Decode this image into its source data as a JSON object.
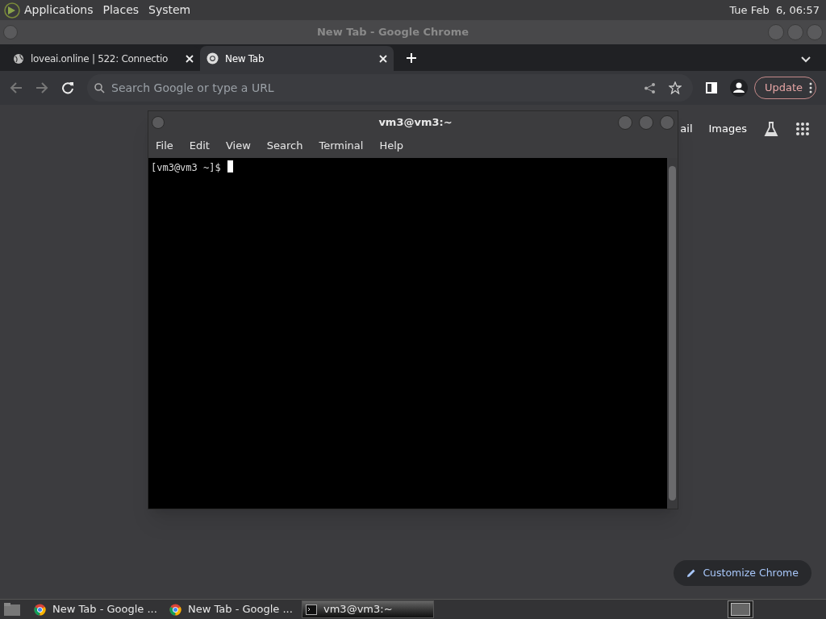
{
  "top_panel": {
    "menus": [
      "Applications",
      "Places",
      "System"
    ],
    "clock": "Tue Feb  6, 06:57"
  },
  "browser": {
    "title": "New Tab - Google Chrome",
    "tabs": [
      {
        "label": "loveai.online | 522: Connectio",
        "kind": "globe",
        "selected": false
      },
      {
        "label": "New Tab",
        "kind": "chrome",
        "selected": true
      }
    ],
    "omnibox": {
      "placeholder": "Search Google or type a URL"
    },
    "update_button": "Update",
    "header_links": [
      "ail",
      "Images"
    ],
    "customize_button": "Customize Chrome"
  },
  "terminal": {
    "title": "vm3@vm3:~",
    "menus": [
      "File",
      "Edit",
      "View",
      "Search",
      "Terminal",
      "Help"
    ],
    "prompt": "[vm3@vm3 ~]$"
  },
  "taskbar": {
    "items": [
      {
        "label": "New Tab - Google ...",
        "kind": "chrome",
        "selected": false
      },
      {
        "label": "New Tab - Google ...",
        "kind": "chrome",
        "selected": false
      },
      {
        "label": "vm3@vm3:~",
        "kind": "terminal",
        "selected": true
      }
    ]
  }
}
